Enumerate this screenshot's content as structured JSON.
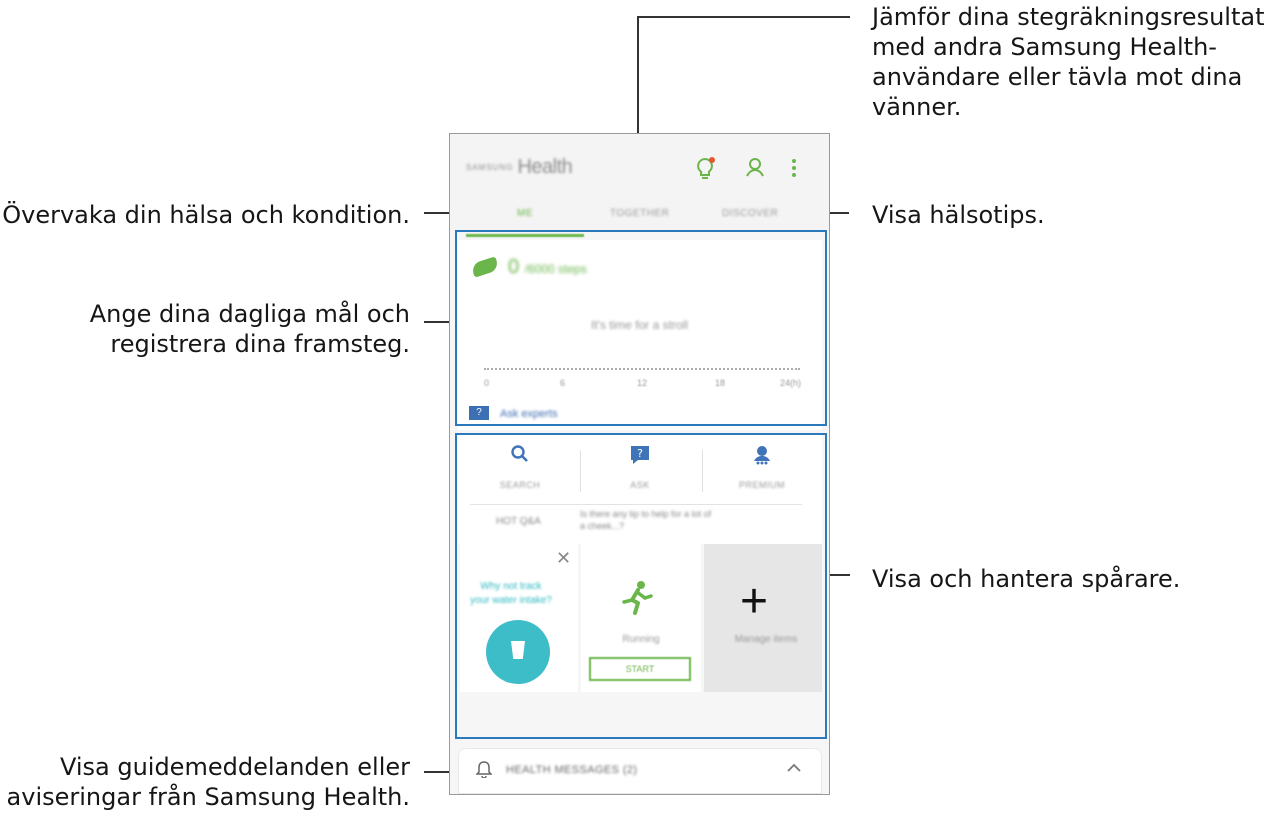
{
  "callouts": {
    "compare": [
      "Jämför dina stegräkningsresultat",
      "med andra Samsung Health-",
      "användare eller tävla mot dina",
      "vänner."
    ],
    "monitor": "Övervaka din hälsa och kondition.",
    "tips": "Visa hälsotips.",
    "goals": [
      "Ange dina dagliga mål och",
      "registrera dina framsteg."
    ],
    "trackers": "Visa och hantera spårare.",
    "messages": [
      "Visa guidemeddelanden eller",
      "aviseringar från Samsung Health."
    ]
  },
  "app": {
    "logo_small": "SAMSUNG",
    "logo": "Health",
    "tabs": [
      "ME",
      "TOGETHER",
      "DISCOVER"
    ],
    "steps": {
      "value": "0",
      "unit": "/6000 steps"
    },
    "hint": "It's time for a stroll",
    "ticks": [
      "0",
      "6",
      "12",
      "18",
      "24(h)"
    ],
    "ask_label": "Ask experts",
    "quick": [
      "SEARCH",
      "ASK",
      "PREMIUM"
    ],
    "tag": "HOT Q&A",
    "tag_text": [
      "Is there any tip to help for a lot of",
      "a cheek...?"
    ],
    "water_q": [
      "Why not track",
      "your water intake?"
    ],
    "run_label": "Running",
    "start_label": "START",
    "manage_label": "Manage items",
    "messages_label": "HEALTH MESSAGES (2)"
  },
  "colors": {
    "accent": "#6bb64a",
    "highlight": "#2a79bd",
    "water": "#3cbdc7",
    "link": "#3d6fb4"
  },
  "icons": [
    "lightbulb-icon",
    "profile-icon",
    "more-icon",
    "shoe-icon",
    "search-icon",
    "ask-icon",
    "premium-icon",
    "close-icon",
    "cup-icon",
    "running-icon",
    "plus-icon",
    "bell-icon",
    "chevron-up-icon"
  ]
}
